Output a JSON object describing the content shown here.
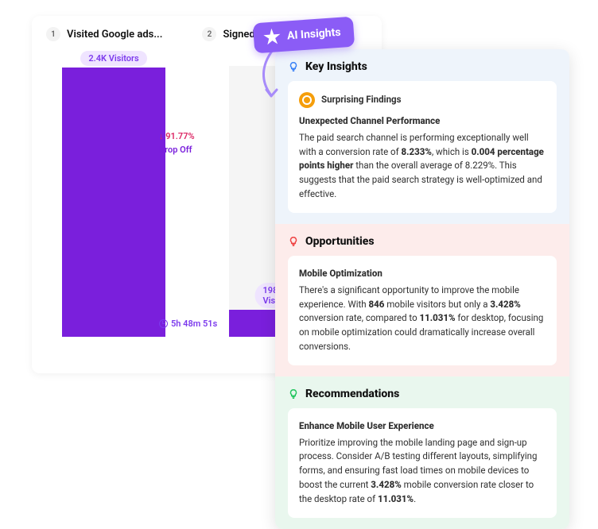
{
  "funnel": {
    "steps": [
      {
        "label": "Visited Google ads...",
        "visitors": "2.4K Visitors"
      },
      {
        "label": "Signed-u",
        "visitors": "198 Visitors"
      }
    ],
    "dropoff": {
      "pct": "91.77%",
      "label": "Drop Off"
    },
    "duration": "5h 48m 51s"
  },
  "aiTag": "AI Insights",
  "insights": {
    "key": {
      "heading": "Key Insights",
      "badge": "Surprising Findings",
      "title": "Unexpected Channel Performance",
      "body_pre": "The paid search channel is performing exceptionally well with a conversion rate of ",
      "rate": "8.233%",
      "body_mid": ", which is ",
      "diff": "0.004 percentage points higher",
      "body_post": " than the overall average of 8.229%. This suggests that the paid search strategy is well-optimized and effective."
    },
    "opp": {
      "heading": "Opportunities",
      "title": "Mobile Optimization",
      "body_pre": "There's a significant opportunity to improve the mobile experience. With ",
      "v1": "846",
      "body_m1": " mobile visitors but only a ",
      "v2": "3.428%",
      "body_m2": " conversion rate, compared to ",
      "v3": "11.031%",
      "body_post": " for desktop, focusing on mobile optimization could dramatically increase overall conversions."
    },
    "rec": {
      "heading": "Recommendations",
      "title": "Enhance Mobile User Experience",
      "body_pre": "Prioritize improving the mobile landing page and sign-up process. Consider A/B testing different layouts, simplifying forms, and ensuring fast load times on mobile devices to boost the current ",
      "v1": "3.428%",
      "body_mid": " mobile conversion rate closer to the desktop rate of ",
      "v2": "11.031%",
      "body_post": "."
    }
  }
}
